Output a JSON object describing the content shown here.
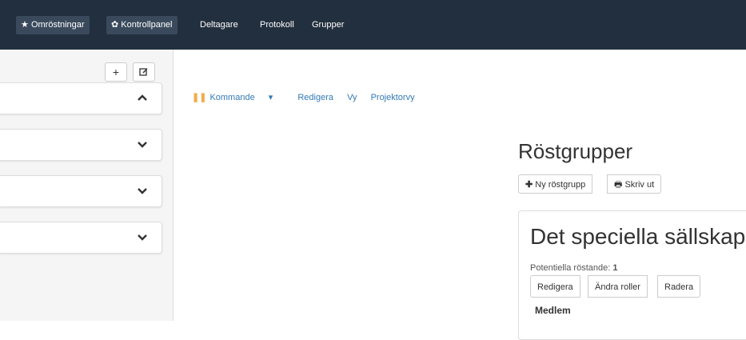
{
  "topnav": {
    "items": [
      {
        "label": "Omröstningar",
        "icon": "star-icon"
      },
      {
        "label": "Kontrollpanel",
        "icon": "gear-icon"
      },
      {
        "label": "Deltagare"
      },
      {
        "label": "Protokoll"
      },
      {
        "label": "Grupper"
      }
    ]
  },
  "sidebar": {
    "add_label": "+",
    "edit_icon": "edit-icon"
  },
  "subnav": {
    "dropdown_label": "Kommande",
    "links": [
      "Redigera",
      "Vy",
      "Projektorvy"
    ]
  },
  "main": {
    "title": "Röstgrupper",
    "new_group_label": "Ny röstgrupp",
    "print_label": "Skriv ut",
    "group": {
      "name": "Det speciella sällskape",
      "potential_label": "Potentiella röstande:",
      "potential_count": "1",
      "actions": [
        "Redigera",
        "Ändra roller",
        "Radera"
      ],
      "member_heading": "Medlem"
    }
  },
  "colors": {
    "nav_bg": "#222f3e",
    "link": "#337ab7",
    "accent": "#f0ad4e"
  }
}
